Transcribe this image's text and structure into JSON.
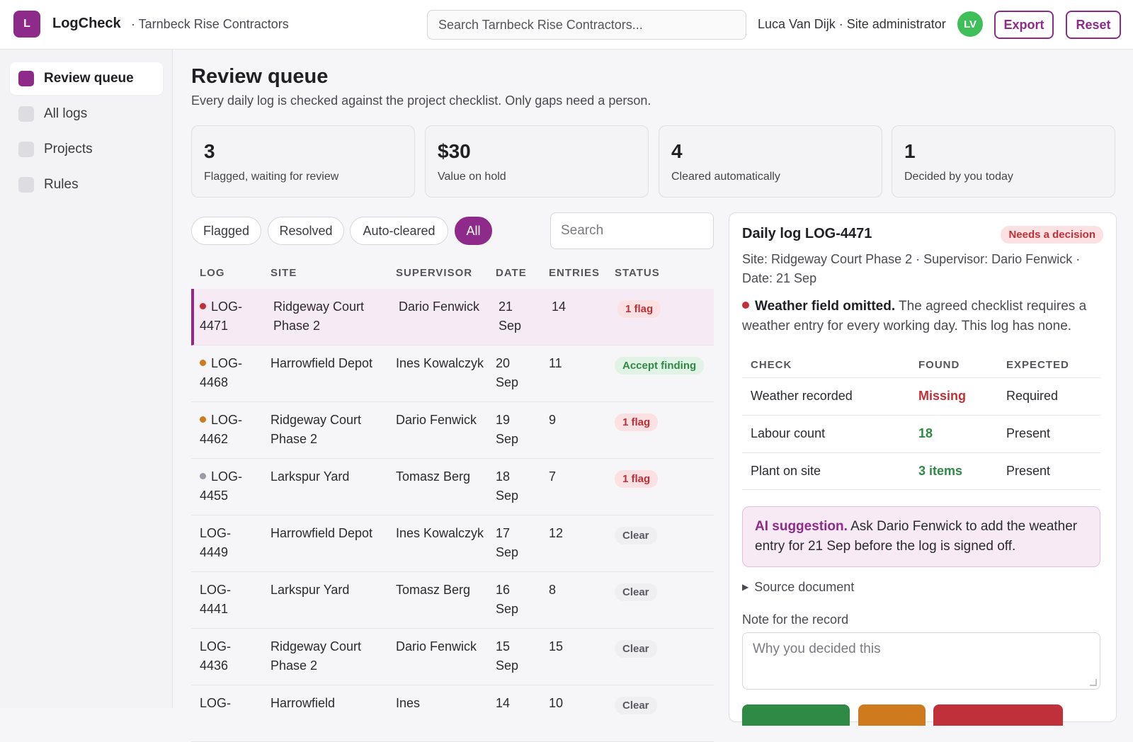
{
  "header": {
    "logo_letter": "L",
    "app_name": "LogCheck",
    "org": "· Tarnbeck Rise Contractors",
    "search_placeholder": "Search Tarnbeck Rise Contractors...",
    "user": "Luca Van Dijk · Site administrator",
    "avatar_initials": "LV",
    "export_label": "Export",
    "reset_label": "Reset"
  },
  "sidebar": {
    "items": [
      {
        "label": "Review queue",
        "active": true
      },
      {
        "label": "All logs",
        "active": false
      },
      {
        "label": "Projects",
        "active": false
      },
      {
        "label": "Rules",
        "active": false
      }
    ]
  },
  "main": {
    "title": "Review queue",
    "subtitle": "Every daily log is checked against the project checklist. Only gaps need a person.",
    "stats": [
      {
        "value": "3",
        "label": "Flagged, waiting for review"
      },
      {
        "value": "$30",
        "label": "Value on hold"
      },
      {
        "value": "4",
        "label": "Cleared automatically"
      },
      {
        "value": "1",
        "label": "Decided by you today"
      }
    ],
    "filters": [
      "Flagged",
      "Resolved",
      "Auto-cleared",
      "All"
    ],
    "active_filter": "All",
    "search_placeholder": "Search"
  },
  "table": {
    "columns": [
      "LOG",
      "SITE",
      "SUPERVISOR",
      "DATE",
      "ENTRIES",
      "STATUS"
    ],
    "rows": [
      {
        "log": "LOG-\n4471",
        "site": "Ridgeway Court Phase 2",
        "supervisor": "Dario Fenwick",
        "date": "21 Sep",
        "entries": "14",
        "status": "1 flag",
        "status_type": "flag",
        "dot": "#c0303a"
      },
      {
        "log": "LOG-\n4468",
        "site": "Harrowfield Depot",
        "supervisor": "Ines Kowalczyk",
        "date": "20 Sep",
        "entries": "11",
        "status": "Accept finding",
        "status_type": "accept",
        "dot": "#d07a1e"
      },
      {
        "log": "LOG-\n4462",
        "site": "Ridgeway Court Phase 2",
        "supervisor": "Dario Fenwick",
        "date": "19 Sep",
        "entries": "9",
        "status": "1 flag",
        "status_type": "flag",
        "dot": "#d07a1e"
      },
      {
        "log": "LOG-\n4455",
        "site": "Larkspur Yard",
        "supervisor": "Tomasz Berg",
        "date": "18 Sep",
        "entries": "7",
        "status": "1 flag",
        "status_type": "flag",
        "dot": "#9a9aa8"
      },
      {
        "log": "LOG-\n4449",
        "site": "Harrowfield Depot",
        "supervisor": "Ines Kowalczyk",
        "date": "17 Sep",
        "entries": "12",
        "status": "Clear",
        "status_type": "clear",
        "dot": ""
      },
      {
        "log": "LOG-\n4441",
        "site": "Larkspur Yard",
        "supervisor": "Tomasz Berg",
        "date": "16 Sep",
        "entries": "8",
        "status": "Clear",
        "status_type": "clear",
        "dot": ""
      },
      {
        "log": "LOG-\n4436",
        "site": "Ridgeway Court Phase 2",
        "supervisor": "Dario Fenwick",
        "date": "15 Sep",
        "entries": "15",
        "status": "Clear",
        "status_type": "clear",
        "dot": ""
      },
      {
        "log": "LOG-",
        "site": "Harrowfield",
        "supervisor": "Ines",
        "date": "14",
        "entries": "10",
        "status": "Clear",
        "status_type": "clear",
        "dot": ""
      }
    ]
  },
  "detail": {
    "title": "Daily log LOG-4471",
    "badge": "Needs a decision",
    "meta": "Site: Ridgeway Court Phase 2 · Supervisor: Dario Fenwick · Date: 21 Sep",
    "finding_title": "Weather field omitted.",
    "finding_text": " The agreed checklist requires a weather entry for every working day. This log has none.",
    "check_columns": [
      "CHECK",
      "FOUND",
      "EXPECTED"
    ],
    "checks": [
      {
        "check": "Weather recorded",
        "found": "Missing",
        "expected": "Required",
        "ok": false
      },
      {
        "check": "Labour count",
        "found": "18",
        "expected": "Present",
        "ok": true
      },
      {
        "check": "Plant on site",
        "found": "3 items",
        "expected": "Present",
        "ok": true
      }
    ],
    "ai_label": "AI suggestion.",
    "ai_text": " Ask Dario Fenwick to add the weather entry for 21 Sep before the log is signed off.",
    "source_doc": "Source document",
    "note_label": "Note for the record",
    "note_placeholder": "Why you decided this",
    "colors": {
      "accent": "#8e2b8a",
      "danger": "#c0303a",
      "success": "#2f8a45",
      "warning": "#d07a1e"
    }
  }
}
